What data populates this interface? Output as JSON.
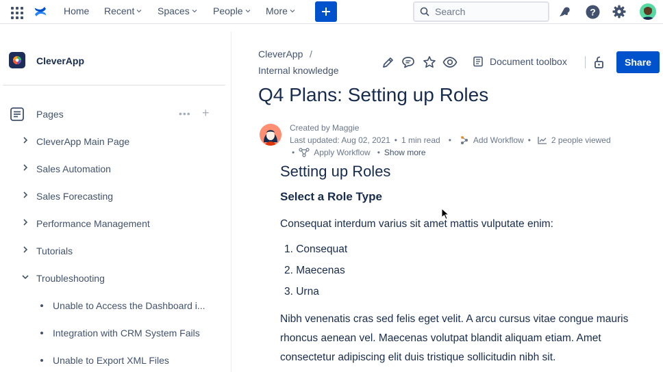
{
  "topbar": {
    "nav": [
      {
        "label": "Home",
        "dropdown": false
      },
      {
        "label": "Recent",
        "dropdown": true
      },
      {
        "label": "Spaces",
        "dropdown": true
      },
      {
        "label": "People",
        "dropdown": true
      },
      {
        "label": "More",
        "dropdown": true
      }
    ],
    "search_placeholder": "Search",
    "brand_color": "#0052cc"
  },
  "sidebar": {
    "space_name": "CleverApp",
    "pages_label": "Pages",
    "tree": [
      {
        "label": "CleverApp Main Page",
        "expanded": false
      },
      {
        "label": "Sales Automation",
        "expanded": false
      },
      {
        "label": "Sales Forecasting",
        "expanded": false
      },
      {
        "label": "Performance Management",
        "expanded": false
      },
      {
        "label": "Tutorials",
        "expanded": false
      },
      {
        "label": "Troubleshooting",
        "expanded": true
      }
    ],
    "children": [
      {
        "label": "Unable to Access the Dashboard i..."
      },
      {
        "label": "Integration with CRM System Fails"
      },
      {
        "label": "Unable to Export XML Files"
      }
    ]
  },
  "page": {
    "breadcrumb": [
      "CleverApp",
      "Internal knowledge"
    ],
    "breadcrumb_separator": "/",
    "document_toolbox": "Document toolbox",
    "share_label": "Share",
    "title": "Q4 Plans: Setting up Roles",
    "byline": {
      "created_by": "Created by Maggie",
      "last_updated": "Last updated: Aug 02, 2021",
      "read_time": "1 min read",
      "add_workflow": "Add Workflow",
      "viewed": "2 people viewed",
      "apply_workflow": "Apply Workflow",
      "show_more": "Show more"
    }
  },
  "content": {
    "heading": "Setting up Roles",
    "subheading": "Select a Role Type",
    "intro": "Consequat interdum varius sit amet mattis vulputate enim:",
    "list": [
      "Consequat",
      "Maecenas",
      "Urna"
    ],
    "body_lines": [
      "Nibh venenatis cras sed felis eget velit. A arcu cursus vitae congue mauris",
      "rhoncus aenean vel. Maecenas volutpat blandit aliquam etiam. Amet",
      "consectetur adipiscing elit duis tristique sollicitudin nibh sit."
    ]
  }
}
